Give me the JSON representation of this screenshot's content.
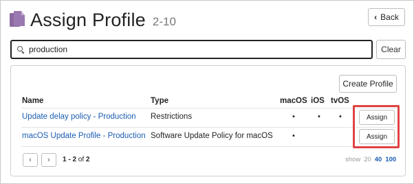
{
  "header": {
    "title": "Assign Profile",
    "count": "2-10",
    "back_label": "Back",
    "back_icon": "chevron-left-icon",
    "page_icon": "documents-icon"
  },
  "search": {
    "value": "production",
    "icon": "search-icon",
    "clear_label": "Clear"
  },
  "panel": {
    "create_label": "Create Profile",
    "columns": {
      "name": "Name",
      "type": "Type",
      "macos": "macOS",
      "ios": "iOS",
      "tvos": "tvOS"
    },
    "rows": [
      {
        "name": "Update delay policy - Production",
        "type": "Restrictions",
        "macos": "•",
        "ios": "•",
        "tvos": "•",
        "action": "Assign"
      },
      {
        "name": "macOS Update Profile - Production",
        "type": "Software Update Policy for macOS",
        "macos": "•",
        "ios": "",
        "tvos": "",
        "action": "Assign"
      }
    ]
  },
  "pagination": {
    "prev_icon": "chevron-left-icon",
    "next_icon": "chevron-right-icon",
    "range": "1 - 2",
    "of_text": "of",
    "total": "2",
    "show_label": "show",
    "sizes": [
      "20",
      "40",
      "100"
    ]
  },
  "colors": {
    "link": "#1a5db3",
    "highlight": "#e04242",
    "icon": "#9a78b0"
  }
}
